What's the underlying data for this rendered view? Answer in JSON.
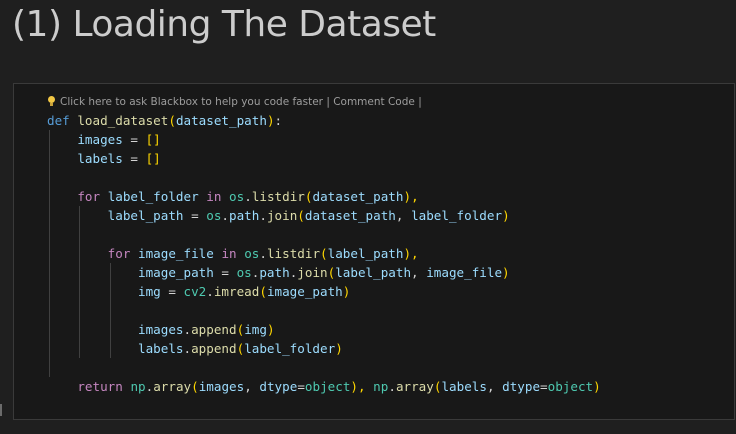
{
  "heading": "(1) Loading The Dataset",
  "hint": {
    "icon": "lightbulb-icon",
    "text": "Click here to ask Blackbox to help you code faster | Comment Code |"
  },
  "code": {
    "lines": [
      [
        [
          "kw-def",
          "def "
        ],
        [
          "fn",
          "load_dataset"
        ],
        [
          "br1",
          "("
        ],
        [
          "var",
          "dataset_path"
        ],
        [
          "br1",
          ")"
        ],
        [
          "pl",
          ":"
        ]
      ],
      [
        [
          "pl",
          "    "
        ],
        [
          "var",
          "images"
        ],
        [
          "pl",
          " = "
        ],
        [
          "br1",
          "[]"
        ]
      ],
      [
        [
          "pl",
          "    "
        ],
        [
          "var",
          "labels"
        ],
        [
          "pl",
          " = "
        ],
        [
          "br1",
          "[]"
        ]
      ],
      [],
      [
        [
          "pl",
          "    "
        ],
        [
          "kw-ctl",
          "for"
        ],
        [
          "pl",
          " "
        ],
        [
          "var",
          "label_folder"
        ],
        [
          "pl",
          " "
        ],
        [
          "kw-ctl",
          "in"
        ],
        [
          "pl",
          " "
        ],
        [
          "cls",
          "os"
        ],
        [
          "pl",
          "."
        ],
        [
          "fn",
          "listdir"
        ],
        [
          "br1",
          "("
        ],
        [
          "var",
          "dataset_path"
        ],
        [
          "br1",
          "),"
        ]
      ],
      [
        [
          "pl",
          "        "
        ],
        [
          "var",
          "label_path"
        ],
        [
          "pl",
          " = "
        ],
        [
          "cls",
          "os"
        ],
        [
          "pl",
          "."
        ],
        [
          "var",
          "path"
        ],
        [
          "pl",
          "."
        ],
        [
          "fn",
          "join"
        ],
        [
          "br1",
          "("
        ],
        [
          "var",
          "dataset_path"
        ],
        [
          "pl",
          ", "
        ],
        [
          "var",
          "label_folder"
        ],
        [
          "br1",
          ")"
        ]
      ],
      [],
      [
        [
          "pl",
          "        "
        ],
        [
          "kw-ctl",
          "for"
        ],
        [
          "pl",
          " "
        ],
        [
          "var",
          "image_file"
        ],
        [
          "pl",
          " "
        ],
        [
          "kw-ctl",
          "in"
        ],
        [
          "pl",
          " "
        ],
        [
          "cls",
          "os"
        ],
        [
          "pl",
          "."
        ],
        [
          "fn",
          "listdir"
        ],
        [
          "br1",
          "("
        ],
        [
          "var",
          "label_path"
        ],
        [
          "br1",
          "),"
        ]
      ],
      [
        [
          "pl",
          "            "
        ],
        [
          "var",
          "image_path"
        ],
        [
          "pl",
          " = "
        ],
        [
          "cls",
          "os"
        ],
        [
          "pl",
          "."
        ],
        [
          "var",
          "path"
        ],
        [
          "pl",
          "."
        ],
        [
          "fn",
          "join"
        ],
        [
          "br1",
          "("
        ],
        [
          "var",
          "label_path"
        ],
        [
          "pl",
          ", "
        ],
        [
          "var",
          "image_file"
        ],
        [
          "br1",
          ")"
        ]
      ],
      [
        [
          "pl",
          "            "
        ],
        [
          "var",
          "img"
        ],
        [
          "pl",
          " = "
        ],
        [
          "cls",
          "cv2"
        ],
        [
          "pl",
          "."
        ],
        [
          "fn",
          "imread"
        ],
        [
          "br1",
          "("
        ],
        [
          "var",
          "image_path"
        ],
        [
          "br1",
          ")"
        ]
      ],
      [],
      [
        [
          "pl",
          "            "
        ],
        [
          "var",
          "images"
        ],
        [
          "pl",
          "."
        ],
        [
          "fn",
          "append"
        ],
        [
          "br1",
          "("
        ],
        [
          "var",
          "img"
        ],
        [
          "br1",
          ")"
        ]
      ],
      [
        [
          "pl",
          "            "
        ],
        [
          "var",
          "labels"
        ],
        [
          "pl",
          "."
        ],
        [
          "fn",
          "append"
        ],
        [
          "br1",
          "("
        ],
        [
          "var",
          "label_folder"
        ],
        [
          "br1",
          ")"
        ]
      ],
      [],
      [
        [
          "pl",
          "    "
        ],
        [
          "kw-ctl",
          "return"
        ],
        [
          "pl",
          " "
        ],
        [
          "cls",
          "np"
        ],
        [
          "pl",
          "."
        ],
        [
          "fn",
          "array"
        ],
        [
          "br1",
          "("
        ],
        [
          "var",
          "images"
        ],
        [
          "pl",
          ", "
        ],
        [
          "var",
          "dtype"
        ],
        [
          "pl",
          "="
        ],
        [
          "bi",
          "object"
        ],
        [
          "br1",
          "),"
        ],
        [
          "pl",
          " "
        ],
        [
          "cls",
          "np"
        ],
        [
          "pl",
          "."
        ],
        [
          "fn",
          "array"
        ],
        [
          "br1",
          "("
        ],
        [
          "var",
          "labels"
        ],
        [
          "pl",
          ", "
        ],
        [
          "var",
          "dtype"
        ],
        [
          "pl",
          "="
        ],
        [
          "bi",
          "object"
        ],
        [
          "br1",
          ")"
        ]
      ]
    ]
  }
}
